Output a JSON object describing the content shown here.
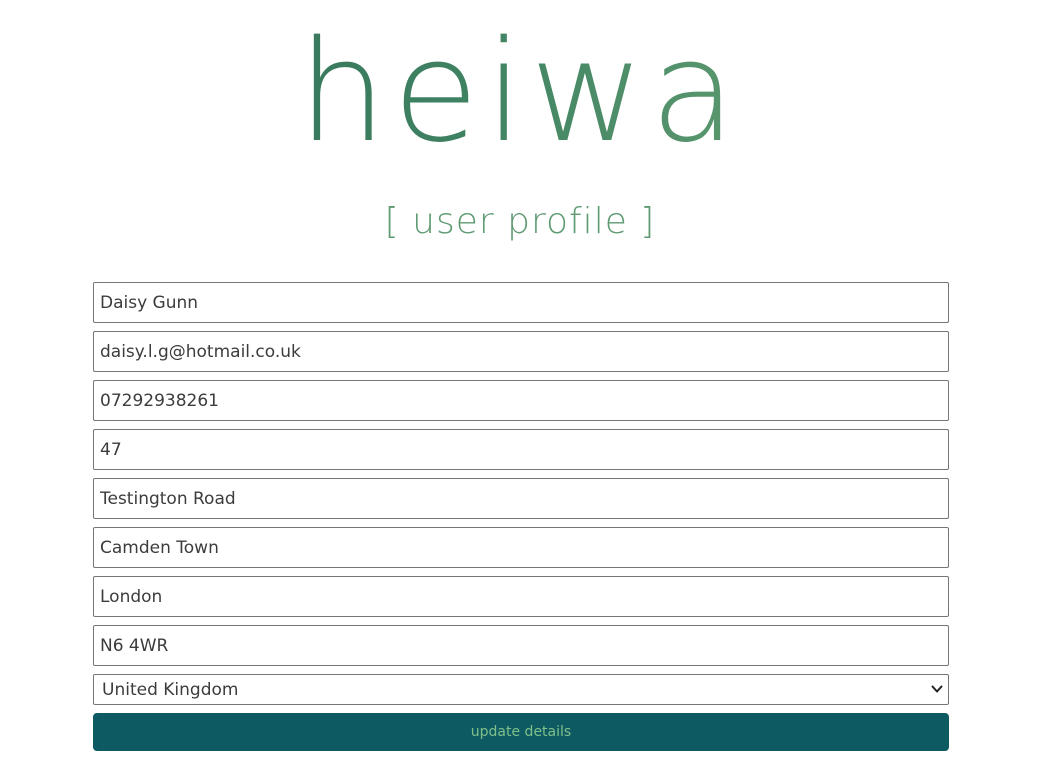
{
  "brand": {
    "logo_text": "heiwa",
    "gradient_colors": [
      "#2f6b57",
      "#3f8262",
      "#77ae7c"
    ]
  },
  "page": {
    "subtitle": "[ user profile ]"
  },
  "form": {
    "fields": [
      {
        "name": "full-name",
        "value": "Daisy Gunn"
      },
      {
        "name": "email",
        "value": "daisy.l.g@hotmail.co.uk"
      },
      {
        "name": "phone",
        "value": "07292938261"
      },
      {
        "name": "house-number",
        "value": "47"
      },
      {
        "name": "street",
        "value": "Testington Road"
      },
      {
        "name": "district",
        "value": "Camden Town"
      },
      {
        "name": "city",
        "value": "London"
      },
      {
        "name": "postcode",
        "value": "N6 4WR"
      }
    ],
    "country": {
      "selected": "United Kingdom",
      "icon": "chevron-down-icon"
    },
    "submit_label": "update details",
    "submit_bg": "#0e5a62",
    "submit_text_color": "#7fc08a"
  }
}
